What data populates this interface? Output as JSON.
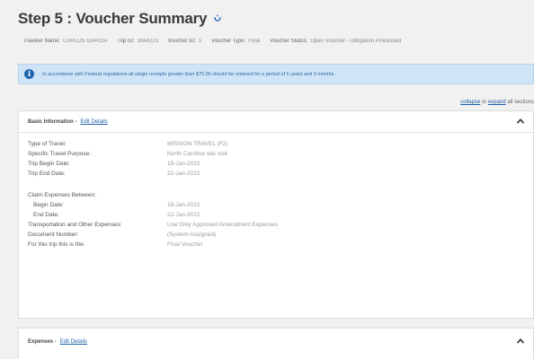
{
  "page": {
    "title": "Step 5 : Voucher Summary"
  },
  "info_bar": [
    {
      "label": "Traveler Name:",
      "value": "CARLOS GARCIA"
    },
    {
      "label": "Trip ID:",
      "value": "3084223"
    },
    {
      "label": "Voucher ID:",
      "value": "1"
    },
    {
      "label": "Voucher Type:",
      "value": "Final"
    },
    {
      "label": "Voucher Status:",
      "value": "Open Voucher - Obligation Processed"
    }
  ],
  "alert": {
    "text": "In accordance with Federal regulations all single receipts greater than $75.00 should be retained for a period of 6 years and 3 months."
  },
  "expand_controls": {
    "collapse": "collapse",
    "or": "or",
    "expand": "expand",
    "suffix": "all sections"
  },
  "basic_info": {
    "heading": "Basic Information -",
    "edit_link": "Edit Details",
    "rows": [
      {
        "label": "Type of Travel:",
        "value": "MISSION TRAVEL (F2)"
      },
      {
        "label": "Specific Travel Purpose:",
        "value": "North Carolina site visit"
      },
      {
        "label": "Trip Begin Date:",
        "value": "19-Jan-2022"
      },
      {
        "label": "Trip End Date:",
        "value": "22-Jan-2022"
      },
      {
        "label": "Claim Expenses Between:",
        "value": ""
      },
      {
        "label": "Begin Date:",
        "value": "19-Jan-2022"
      },
      {
        "label": "End Date:",
        "value": "22-Jan-2022"
      },
      {
        "label": "Transportation and Other Expenses:",
        "value": "Use Only Approved Amendment Expenses"
      },
      {
        "label": "Document Number:",
        "value": "(System Assigned)"
      },
      {
        "label": "For this trip this is the:",
        "value": "Final Voucher"
      }
    ]
  },
  "expenses": {
    "heading": "Expenses -",
    "edit_link": "Edit Details"
  }
}
